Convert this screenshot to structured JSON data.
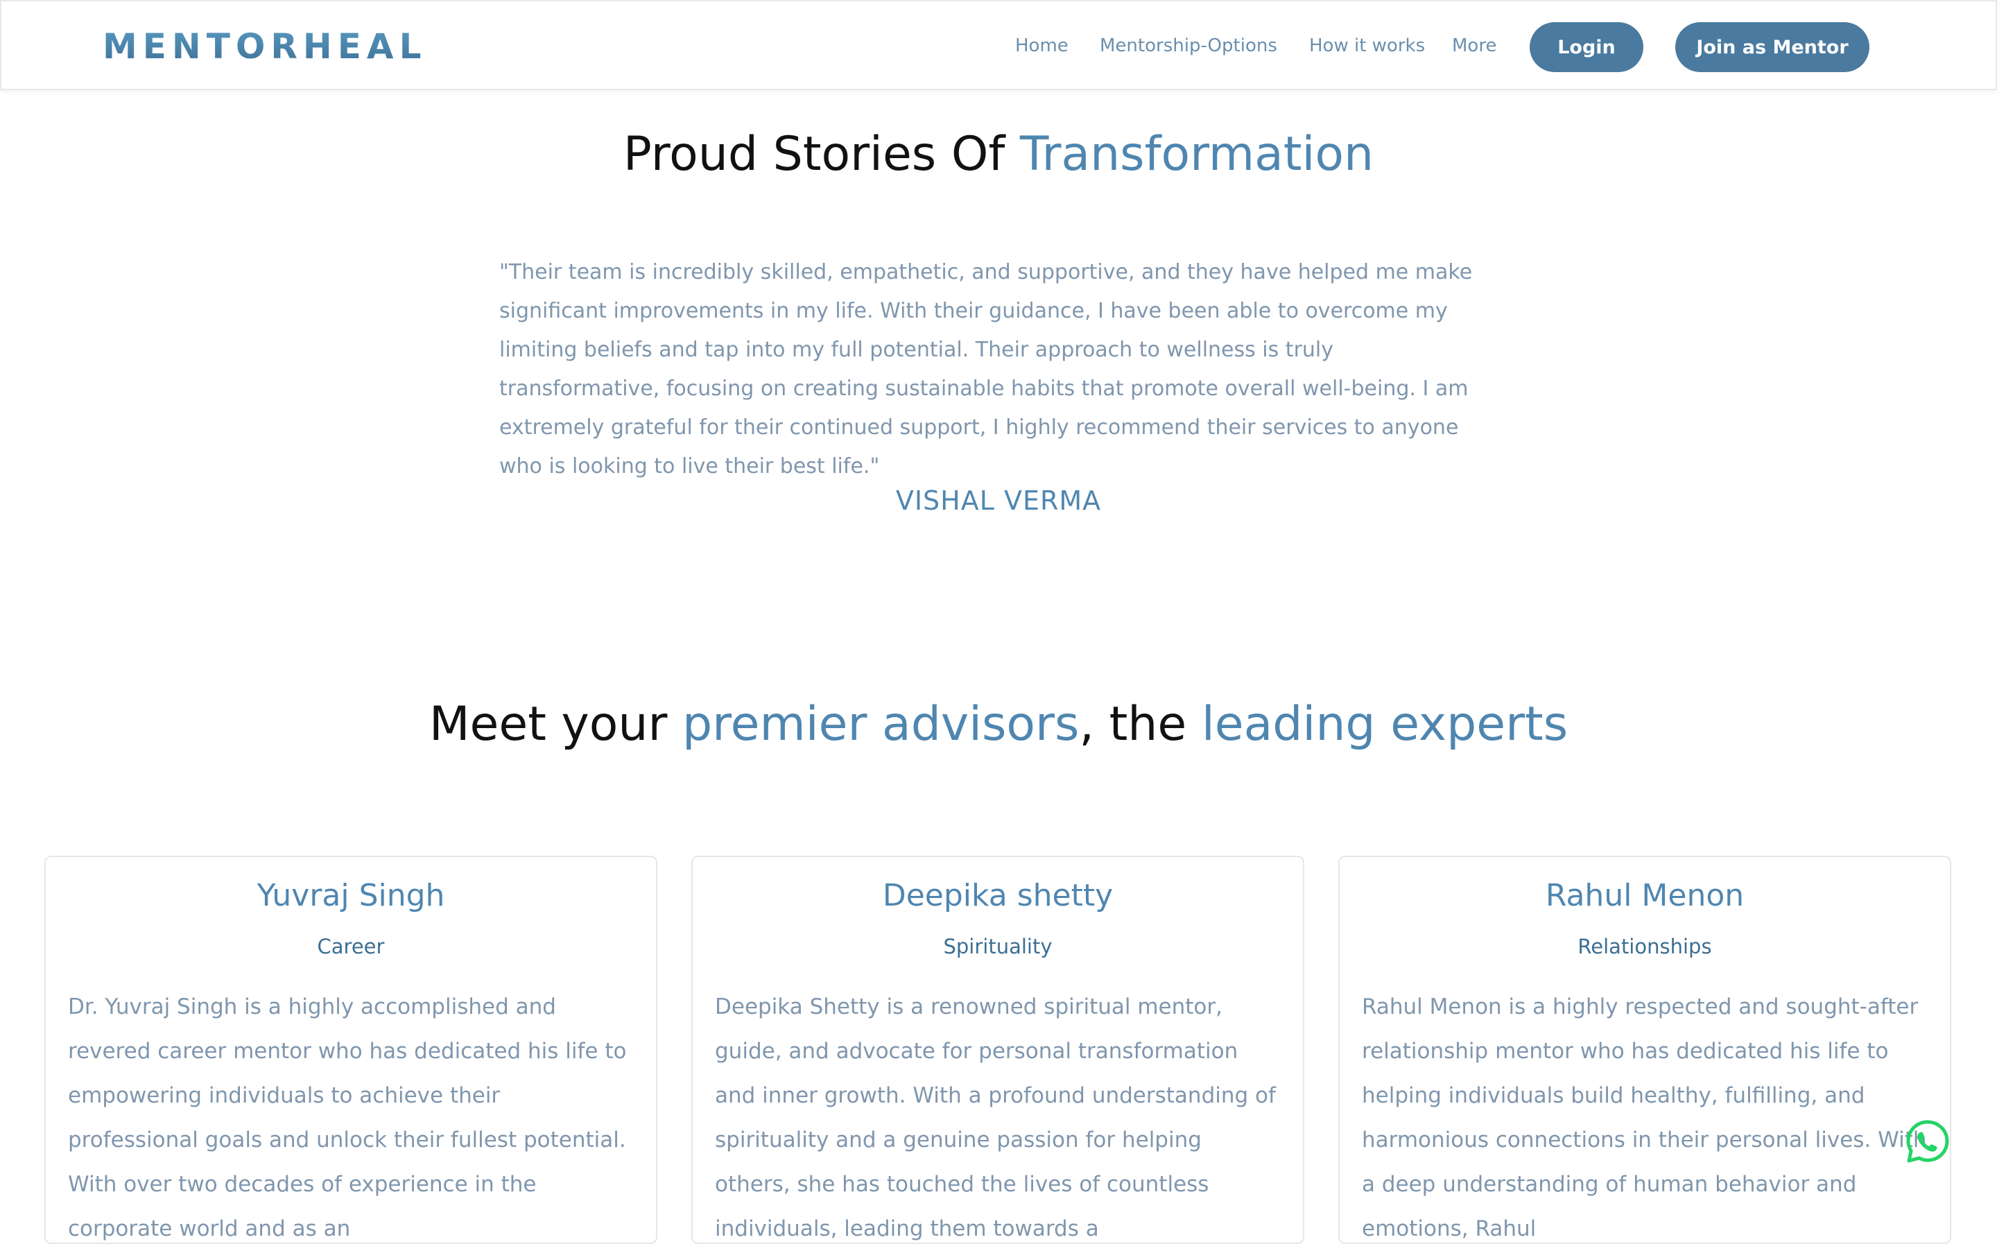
{
  "nav": {
    "logo": "MENTORHEAL",
    "links": [
      "Home",
      "Mentorship-Options",
      "How it works",
      "More"
    ],
    "login_label": "Login",
    "join_label": "Join as Mentor"
  },
  "testimonials": {
    "title_main": "Proud Stories Of ",
    "title_accent": "Transformation",
    "quote": "\"Their team is incredibly skilled, empathetic, and supportive, and they have helped me make significant improvements in my life. With their guidance, I have been able to overcome my limiting beliefs and tap into my full potential. Their approach to wellness is truly transformative, focusing on creating sustainable habits that promote overall well-being. I am extremely grateful for their continued support, I highly recommend their services to anyone who is looking to live their best life.\"",
    "author": "VISHAL VERMA"
  },
  "advisors": {
    "title_part1": "Meet your ",
    "title_accent1": "premier advisors",
    "title_part2": ", the ",
    "title_accent2": "leading experts",
    "cards": [
      {
        "name": "Yuvraj Singh",
        "category": "Career",
        "bio": "Dr. Yuvraj Singh is a highly accomplished and revered career mentor who has dedicated his life to empowering individuals to achieve their professional goals and unlock their fullest potential. With over two decades of experience in the corporate world and as an"
      },
      {
        "name": "Deepika shetty",
        "category": "Spirituality",
        "bio": "Deepika Shetty is a renowned spiritual mentor, guide, and advocate for personal transformation and inner growth. With a profound understanding of spirituality and a genuine passion for helping others, she has touched the lives of countless individuals, leading them towards a"
      },
      {
        "name": "Rahul Menon",
        "category": "Relationships",
        "bio": "Rahul Menon is a highly respected and sought-after relationship mentor who has dedicated his life to helping individuals build healthy, fulfilling, and harmonious connections in their personal lives. With a deep understanding of human behavior and emotions, Rahul"
      }
    ]
  },
  "colors": {
    "accent": "#4f86b0",
    "button": "#4a7a9f",
    "body_text": "#7f96ad",
    "whatsapp": "#25d366"
  },
  "icons": {
    "whatsapp": "whatsapp-icon"
  }
}
